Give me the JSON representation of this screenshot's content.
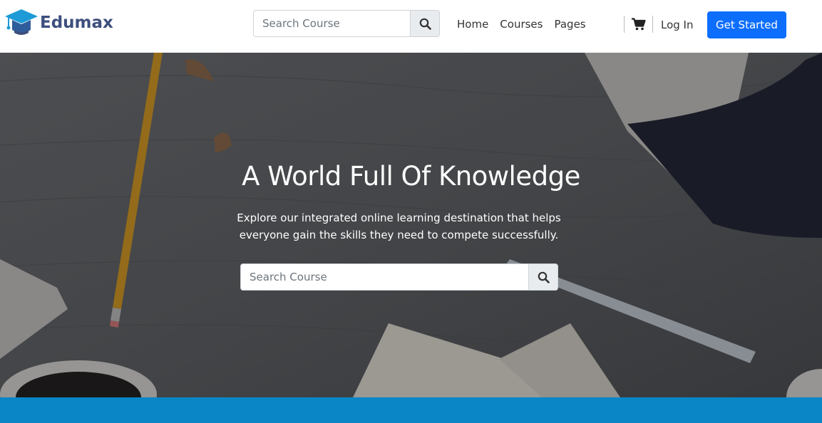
{
  "brand": {
    "name": "Edumax",
    "icon": "graduation-cap-icon",
    "color": "#3d4f7d"
  },
  "header": {
    "search": {
      "placeholder": "Search Course",
      "icon": "search-icon"
    },
    "nav": [
      {
        "label": "Home"
      },
      {
        "label": "Courses"
      },
      {
        "label": "Pages"
      }
    ],
    "cart_icon": "shopping-cart-icon",
    "login_label": "Log In",
    "cta_label": "Get Started",
    "cta_color": "#0d6efd"
  },
  "hero": {
    "title": "A World Full Of Knowledge",
    "subtitle": "Explore our integrated online learning destination that helps everyone gain the skills they need to compete successfully.",
    "search": {
      "placeholder": "Search Course",
      "icon": "search-icon"
    }
  },
  "colors": {
    "band": "#0a86c6",
    "search_button_bg": "#e9ecef"
  }
}
